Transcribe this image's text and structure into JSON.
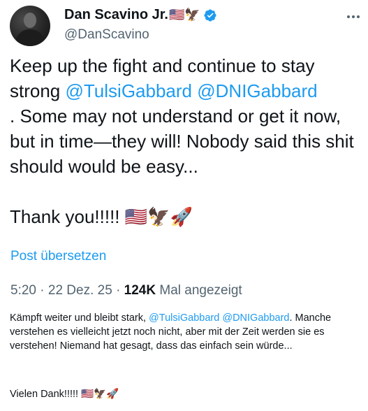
{
  "author": {
    "display_name": "Dan Scavino Jr.",
    "name_emojis": "🇺🇸🦅",
    "handle": "@DanScavino"
  },
  "tweet": {
    "text_1": "Keep up the fight and continue to stay strong ",
    "mention_1": "@TulsiGabbard",
    "text_2": " ",
    "mention_2": "@DNIGabbard",
    "text_3": "\n. Some may not understand or get it now, but in time—they will! Nobody said this shit should would be easy...\n\nThank you!!!!! 🇺🇸🦅🚀"
  },
  "translate_label": "Post übersetzen",
  "meta": {
    "time": "5:20",
    "date": "22 Dez. 25",
    "views_count": "124K",
    "views_label": "Mal angezeigt"
  },
  "translation": {
    "text_1": "Kämpft weiter und bleibt stark, ",
    "mention_1": "@TulsiGabbard",
    "text_2": " ",
    "mention_2": "@DNIGabbard",
    "text_3": ". Manche verstehen es vielleicht jetzt noch nicht, aber mit der Zeit werden sie es verstehen! Niemand hat gesagt, dass das einfach sein würde...",
    "thanks": "Vielen Dank!!!!! 🇺🇸🦅🚀"
  },
  "colors": {
    "link": "#1d9bf0",
    "secondary": "#536471",
    "text": "#0f1419",
    "verified": "#1d9bf0"
  }
}
